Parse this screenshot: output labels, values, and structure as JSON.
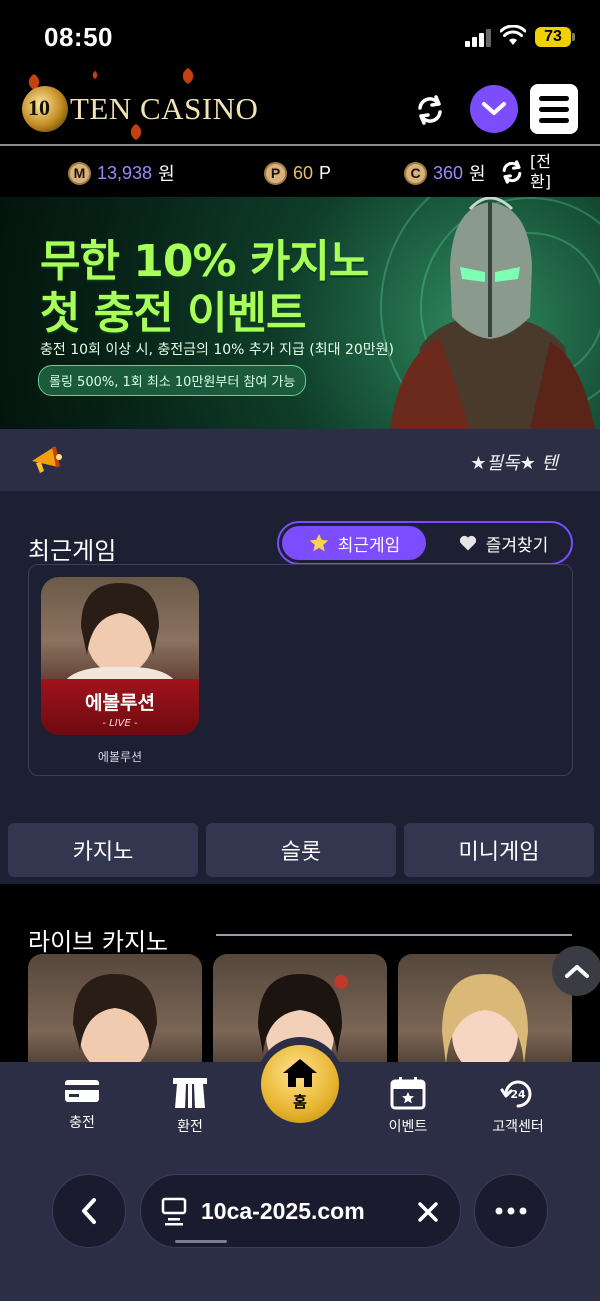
{
  "status": {
    "time": "08:50",
    "battery": "73"
  },
  "header": {
    "logo_text": "TEN CASINO"
  },
  "balance": {
    "money": {
      "icon": "M",
      "value": "13,938",
      "unit": "원"
    },
    "point": {
      "icon": "P",
      "value": "60",
      "unit": "P"
    },
    "comp": {
      "icon": "C",
      "value": "360",
      "unit": "원"
    },
    "switch_label_1": "[전",
    "switch_label_2": "환]"
  },
  "banner": {
    "line1": "무한 10% 카지노",
    "line2": "첫 충전 이벤트",
    "sub": "충전 10회 이상 시, 충전금의 10% 추가 지급 (최대 20만원)",
    "pill": "롤링 500%, 1회 최소 10만원부터 참여 가능"
  },
  "notice": {
    "text": "★필독★ 텐"
  },
  "recent": {
    "title": "최근게임",
    "tabs": [
      {
        "label": "최근게임",
        "icon": "star-icon",
        "active": true
      },
      {
        "label": "즐겨찾기",
        "icon": "heart-icon",
        "active": false
      }
    ],
    "games": [
      {
        "card_title": "에볼루션",
        "card_sub": "- LIVE -",
        "name": "에볼루션"
      }
    ]
  },
  "categories": [
    "카지노",
    "슬롯",
    "미니게임"
  ],
  "live": {
    "title": "라이브 카지노"
  },
  "bottom_nav": {
    "items": [
      {
        "label": "충전",
        "icon": "card-icon"
      },
      {
        "label": "환전",
        "icon": "exchange-icon"
      },
      {
        "label": "이벤트",
        "icon": "calendar-star-icon"
      },
      {
        "label": "고객센터",
        "icon": "support-24-icon"
      }
    ],
    "home_label": "홈"
  },
  "browser": {
    "url": "10ca-2025.com"
  },
  "colors": {
    "accent": "#7c4dff",
    "panel": "#2c2e45",
    "gold": "#e7b430"
  }
}
